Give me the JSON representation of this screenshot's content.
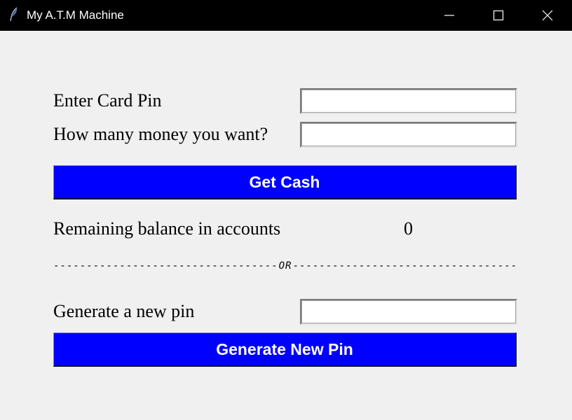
{
  "window": {
    "title": "My A.T.M Machine",
    "icon": "feather-icon",
    "controls": [
      "minimize-icon",
      "maximize-icon",
      "close-icon"
    ]
  },
  "form": {
    "card_pin_label": "Enter Card Pin",
    "card_pin_value": "",
    "amount_label": "How many money you want?",
    "amount_value": "",
    "get_cash_label": "Get Cash",
    "balance_label": "Remaining balance in accounts",
    "balance_value": "0",
    "divider_or": "OR",
    "new_pin_label": "Generate a new pin",
    "new_pin_value": "",
    "generate_pin_label": "Generate New Pin"
  },
  "colors": {
    "button_bg": "#0000ff",
    "button_text": "#ffffff",
    "window_bg": "#f0f0f0",
    "titlebar_bg": "#000000"
  }
}
